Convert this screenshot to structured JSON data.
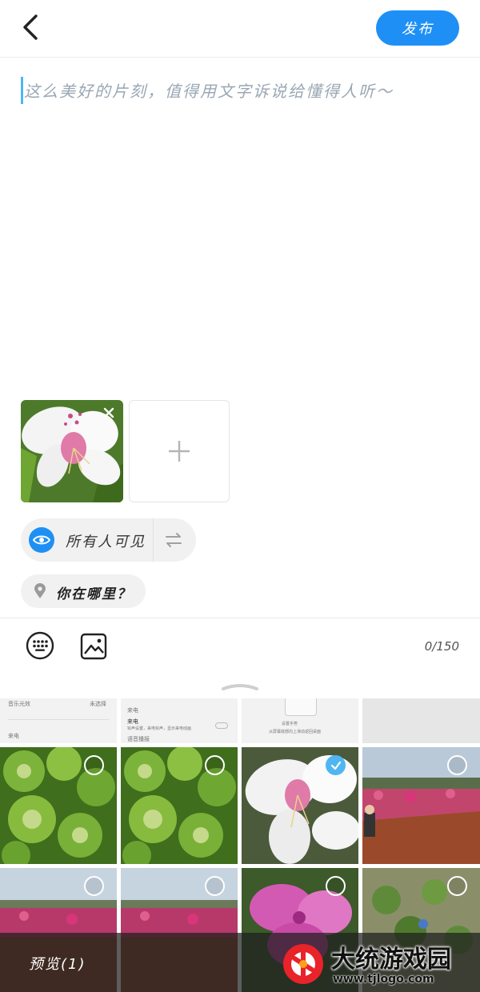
{
  "header": {
    "publish_label": "发布"
  },
  "editor": {
    "placeholder": "这么美好的片刻，值得用文字诉说给懂得人听～"
  },
  "visibility": {
    "label": "所有人可见"
  },
  "location": {
    "label": "你在哪里？"
  },
  "toolbar": {
    "counter": "0/150"
  },
  "gallery": {
    "screenshots": [
      {
        "line1": "音乐光效",
        "line1_right": "未选择",
        "line2": "来电"
      },
      {
        "line1": "来电",
        "line2": "来电",
        "line3": "铃声设置，来电铃声，显示来电动画",
        "line4": "语音播报"
      },
      {
        "line1": "设置手势",
        "line2": "从屏幕底部向上滑动返回桌面"
      },
      {}
    ],
    "photos": [
      {
        "subject": "clover-leaves",
        "selected": false
      },
      {
        "subject": "clover-leaves",
        "selected": false
      },
      {
        "subject": "white-azalea",
        "selected": true
      },
      {
        "subject": "flower-bed-with-person",
        "selected": false
      },
      {
        "subject": "flower-garden",
        "selected": false
      },
      {
        "subject": "flower-garden",
        "selected": false
      },
      {
        "subject": "pink-azalea",
        "selected": false
      },
      {
        "subject": "green-plants",
        "selected": false
      }
    ]
  },
  "preview": {
    "label": "预览(1)"
  },
  "watermark": {
    "title": "大统游戏园",
    "url": "www.tjlogo.com"
  },
  "colors": {
    "accent": "#1e90f5",
    "check": "#4fb6f2"
  }
}
